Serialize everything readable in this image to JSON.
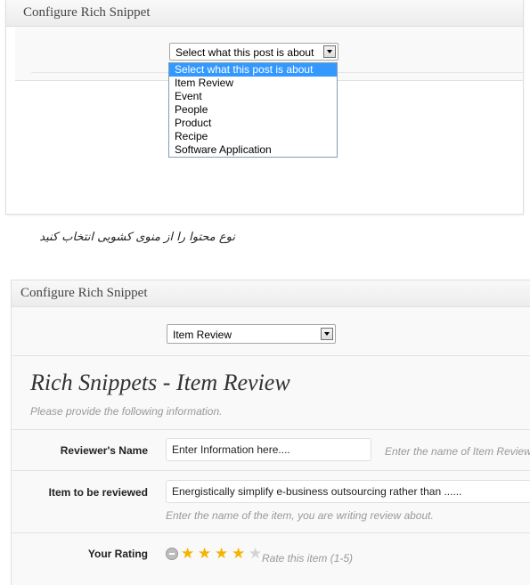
{
  "panel1": {
    "title": "Configure Rich Snippet",
    "select_value": "Select what this post is about",
    "options": [
      "Select what this post is about",
      "Item Review",
      "Event",
      "People",
      "Product",
      "Recipe",
      "Software Application"
    ],
    "highlighted_option": "Select what this post is about"
  },
  "caption": "نوع محتوا را از منوی کشویی انتخاب کنید",
  "panel2": {
    "title": "Configure Rich Snippet",
    "select_value": "Item Review",
    "heading": "Rich Snippets - Item Review",
    "subheading": "Please provide the following information.",
    "fields": [
      {
        "label": "Reviewer's Name",
        "value": "Enter Information here....",
        "hint": "Enter the name of Item Reviewer"
      },
      {
        "label": "Item to be reviewed",
        "value": "Energistically simplify e-business outsourcing rather than ......",
        "hint": "Enter the name of the item, you are writing review about."
      }
    ],
    "rating": {
      "label": "Your Rating",
      "value": 4,
      "max": 5,
      "hint": "Rate this item (1-5)"
    }
  },
  "colors": {
    "highlight": "#3399ff",
    "star_filled": "#f5b400",
    "star_empty": "#d4d4d4"
  }
}
